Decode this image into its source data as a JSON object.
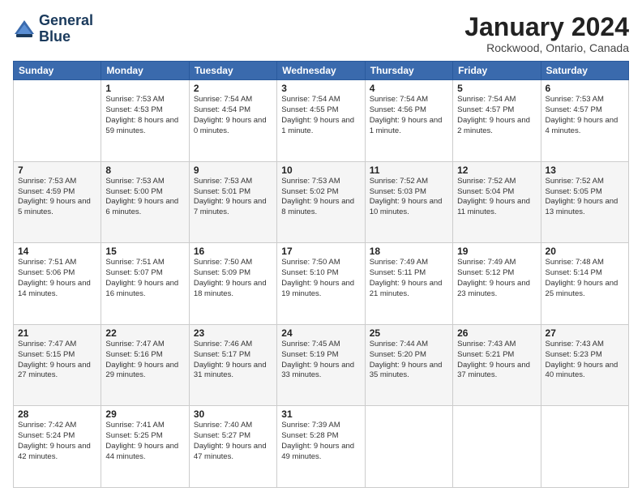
{
  "logo": {
    "line1": "General",
    "line2": "Blue"
  },
  "title": "January 2024",
  "location": "Rockwood, Ontario, Canada",
  "days_header": [
    "Sunday",
    "Monday",
    "Tuesday",
    "Wednesday",
    "Thursday",
    "Friday",
    "Saturday"
  ],
  "weeks": [
    [
      {
        "day": "",
        "info": ""
      },
      {
        "day": "1",
        "info": "Sunrise: 7:53 AM\nSunset: 4:53 PM\nDaylight: 8 hours\nand 59 minutes."
      },
      {
        "day": "2",
        "info": "Sunrise: 7:54 AM\nSunset: 4:54 PM\nDaylight: 9 hours\nand 0 minutes."
      },
      {
        "day": "3",
        "info": "Sunrise: 7:54 AM\nSunset: 4:55 PM\nDaylight: 9 hours\nand 1 minute."
      },
      {
        "day": "4",
        "info": "Sunrise: 7:54 AM\nSunset: 4:56 PM\nDaylight: 9 hours\nand 1 minute."
      },
      {
        "day": "5",
        "info": "Sunrise: 7:54 AM\nSunset: 4:57 PM\nDaylight: 9 hours\nand 2 minutes."
      },
      {
        "day": "6",
        "info": "Sunrise: 7:53 AM\nSunset: 4:57 PM\nDaylight: 9 hours\nand 4 minutes."
      }
    ],
    [
      {
        "day": "7",
        "info": "Sunrise: 7:53 AM\nSunset: 4:59 PM\nDaylight: 9 hours\nand 5 minutes."
      },
      {
        "day": "8",
        "info": "Sunrise: 7:53 AM\nSunset: 5:00 PM\nDaylight: 9 hours\nand 6 minutes."
      },
      {
        "day": "9",
        "info": "Sunrise: 7:53 AM\nSunset: 5:01 PM\nDaylight: 9 hours\nand 7 minutes."
      },
      {
        "day": "10",
        "info": "Sunrise: 7:53 AM\nSunset: 5:02 PM\nDaylight: 9 hours\nand 8 minutes."
      },
      {
        "day": "11",
        "info": "Sunrise: 7:52 AM\nSunset: 5:03 PM\nDaylight: 9 hours\nand 10 minutes."
      },
      {
        "day": "12",
        "info": "Sunrise: 7:52 AM\nSunset: 5:04 PM\nDaylight: 9 hours\nand 11 minutes."
      },
      {
        "day": "13",
        "info": "Sunrise: 7:52 AM\nSunset: 5:05 PM\nDaylight: 9 hours\nand 13 minutes."
      }
    ],
    [
      {
        "day": "14",
        "info": "Sunrise: 7:51 AM\nSunset: 5:06 PM\nDaylight: 9 hours\nand 14 minutes."
      },
      {
        "day": "15",
        "info": "Sunrise: 7:51 AM\nSunset: 5:07 PM\nDaylight: 9 hours\nand 16 minutes."
      },
      {
        "day": "16",
        "info": "Sunrise: 7:50 AM\nSunset: 5:09 PM\nDaylight: 9 hours\nand 18 minutes."
      },
      {
        "day": "17",
        "info": "Sunrise: 7:50 AM\nSunset: 5:10 PM\nDaylight: 9 hours\nand 19 minutes."
      },
      {
        "day": "18",
        "info": "Sunrise: 7:49 AM\nSunset: 5:11 PM\nDaylight: 9 hours\nand 21 minutes."
      },
      {
        "day": "19",
        "info": "Sunrise: 7:49 AM\nSunset: 5:12 PM\nDaylight: 9 hours\nand 23 minutes."
      },
      {
        "day": "20",
        "info": "Sunrise: 7:48 AM\nSunset: 5:14 PM\nDaylight: 9 hours\nand 25 minutes."
      }
    ],
    [
      {
        "day": "21",
        "info": "Sunrise: 7:47 AM\nSunset: 5:15 PM\nDaylight: 9 hours\nand 27 minutes."
      },
      {
        "day": "22",
        "info": "Sunrise: 7:47 AM\nSunset: 5:16 PM\nDaylight: 9 hours\nand 29 minutes."
      },
      {
        "day": "23",
        "info": "Sunrise: 7:46 AM\nSunset: 5:17 PM\nDaylight: 9 hours\nand 31 minutes."
      },
      {
        "day": "24",
        "info": "Sunrise: 7:45 AM\nSunset: 5:19 PM\nDaylight: 9 hours\nand 33 minutes."
      },
      {
        "day": "25",
        "info": "Sunrise: 7:44 AM\nSunset: 5:20 PM\nDaylight: 9 hours\nand 35 minutes."
      },
      {
        "day": "26",
        "info": "Sunrise: 7:43 AM\nSunset: 5:21 PM\nDaylight: 9 hours\nand 37 minutes."
      },
      {
        "day": "27",
        "info": "Sunrise: 7:43 AM\nSunset: 5:23 PM\nDaylight: 9 hours\nand 40 minutes."
      }
    ],
    [
      {
        "day": "28",
        "info": "Sunrise: 7:42 AM\nSunset: 5:24 PM\nDaylight: 9 hours\nand 42 minutes."
      },
      {
        "day": "29",
        "info": "Sunrise: 7:41 AM\nSunset: 5:25 PM\nDaylight: 9 hours\nand 44 minutes."
      },
      {
        "day": "30",
        "info": "Sunrise: 7:40 AM\nSunset: 5:27 PM\nDaylight: 9 hours\nand 47 minutes."
      },
      {
        "day": "31",
        "info": "Sunrise: 7:39 AM\nSunset: 5:28 PM\nDaylight: 9 hours\nand 49 minutes."
      },
      {
        "day": "",
        "info": ""
      },
      {
        "day": "",
        "info": ""
      },
      {
        "day": "",
        "info": ""
      }
    ]
  ]
}
